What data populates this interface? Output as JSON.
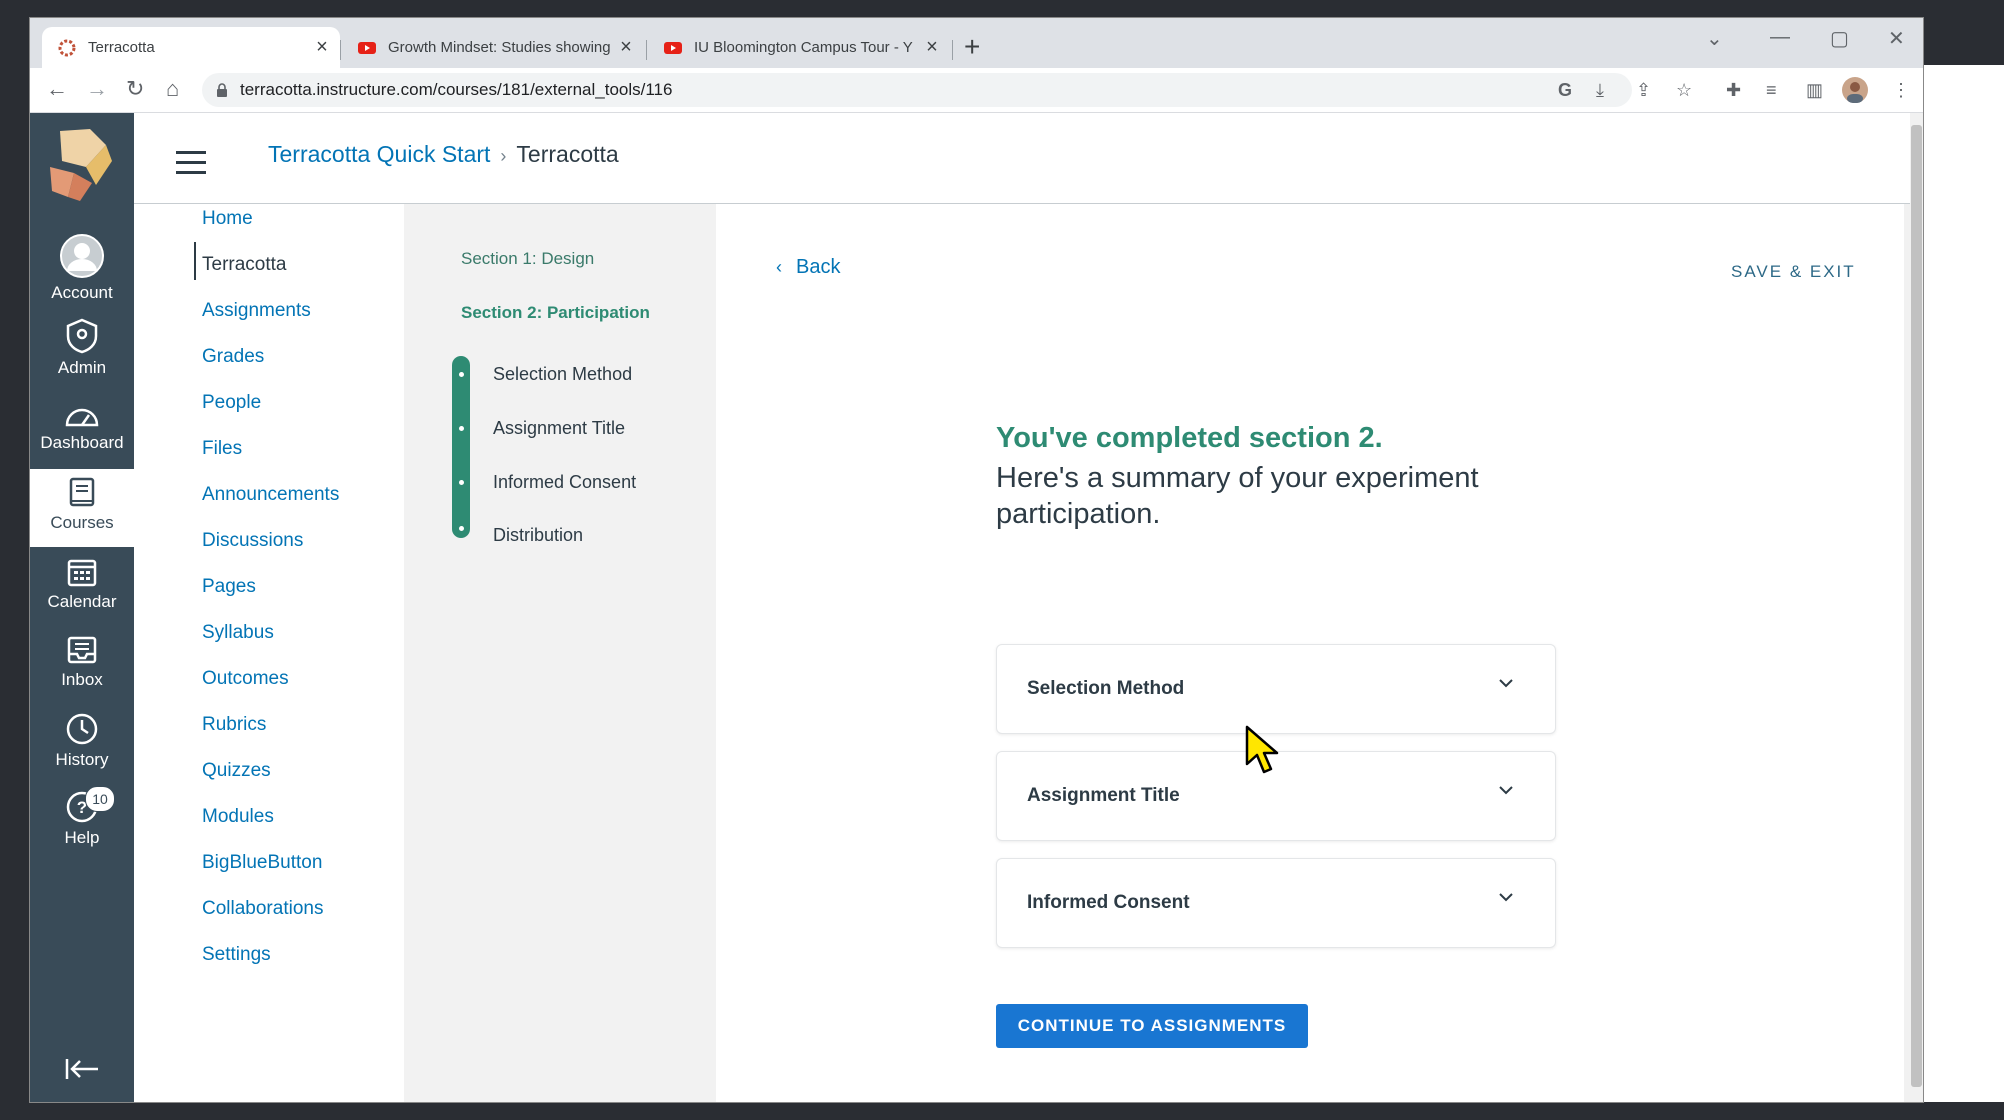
{
  "browser": {
    "tabs": [
      {
        "title": "Terracotta",
        "active": true
      },
      {
        "title": "Growth Mindset: Studies showing",
        "active": false
      },
      {
        "title": "IU Bloomington Campus Tour - Y",
        "active": false
      }
    ],
    "url": "terracotta.instructure.com/courses/181/external_tools/116"
  },
  "global_nav": {
    "items": [
      {
        "label": "Account",
        "icon": "account-avatar-icon"
      },
      {
        "label": "Admin",
        "icon": "shield-icon"
      },
      {
        "label": "Dashboard",
        "icon": "gauge-icon"
      },
      {
        "label": "Courses",
        "icon": "book-icon"
      },
      {
        "label": "Calendar",
        "icon": "calendar-icon"
      },
      {
        "label": "Inbox",
        "icon": "inbox-icon"
      },
      {
        "label": "History",
        "icon": "clock-icon"
      },
      {
        "label": "Help",
        "icon": "help-icon"
      }
    ],
    "help_badge": "10"
  },
  "breadcrumb": {
    "course": "Terracotta Quick Start",
    "current": "Terracotta"
  },
  "course_nav": [
    {
      "label": "Home"
    },
    {
      "label": "Terracotta"
    },
    {
      "label": "Assignments"
    },
    {
      "label": "Grades"
    },
    {
      "label": "People"
    },
    {
      "label": "Files"
    },
    {
      "label": "Announcements"
    },
    {
      "label": "Discussions"
    },
    {
      "label": "Pages"
    },
    {
      "label": "Syllabus"
    },
    {
      "label": "Outcomes"
    },
    {
      "label": "Rubrics"
    },
    {
      "label": "Quizzes"
    },
    {
      "label": "Modules"
    },
    {
      "label": "BigBlueButton"
    },
    {
      "label": "Collaborations"
    },
    {
      "label": "Settings"
    }
  ],
  "steps": {
    "section1": "Section 1: Design",
    "section2": "Section 2: Participation",
    "substeps": [
      "Selection Method",
      "Assignment Title",
      "Informed Consent",
      "Distribution"
    ]
  },
  "main": {
    "back": "Back",
    "save_exit": "SAVE & EXIT",
    "title": "You've completed section 2.",
    "subtitle": "Here's a summary of your experiment participation.",
    "accordions": [
      "Selection Method",
      "Assignment Title",
      "Informed Consent"
    ],
    "continue_button": "CONTINUE TO ASSIGNMENTS"
  },
  "colors": {
    "nav_bg": "#394b58",
    "accent_green": "#2e8b73",
    "link_blue": "#0374b5",
    "button_blue": "#1976d2"
  }
}
